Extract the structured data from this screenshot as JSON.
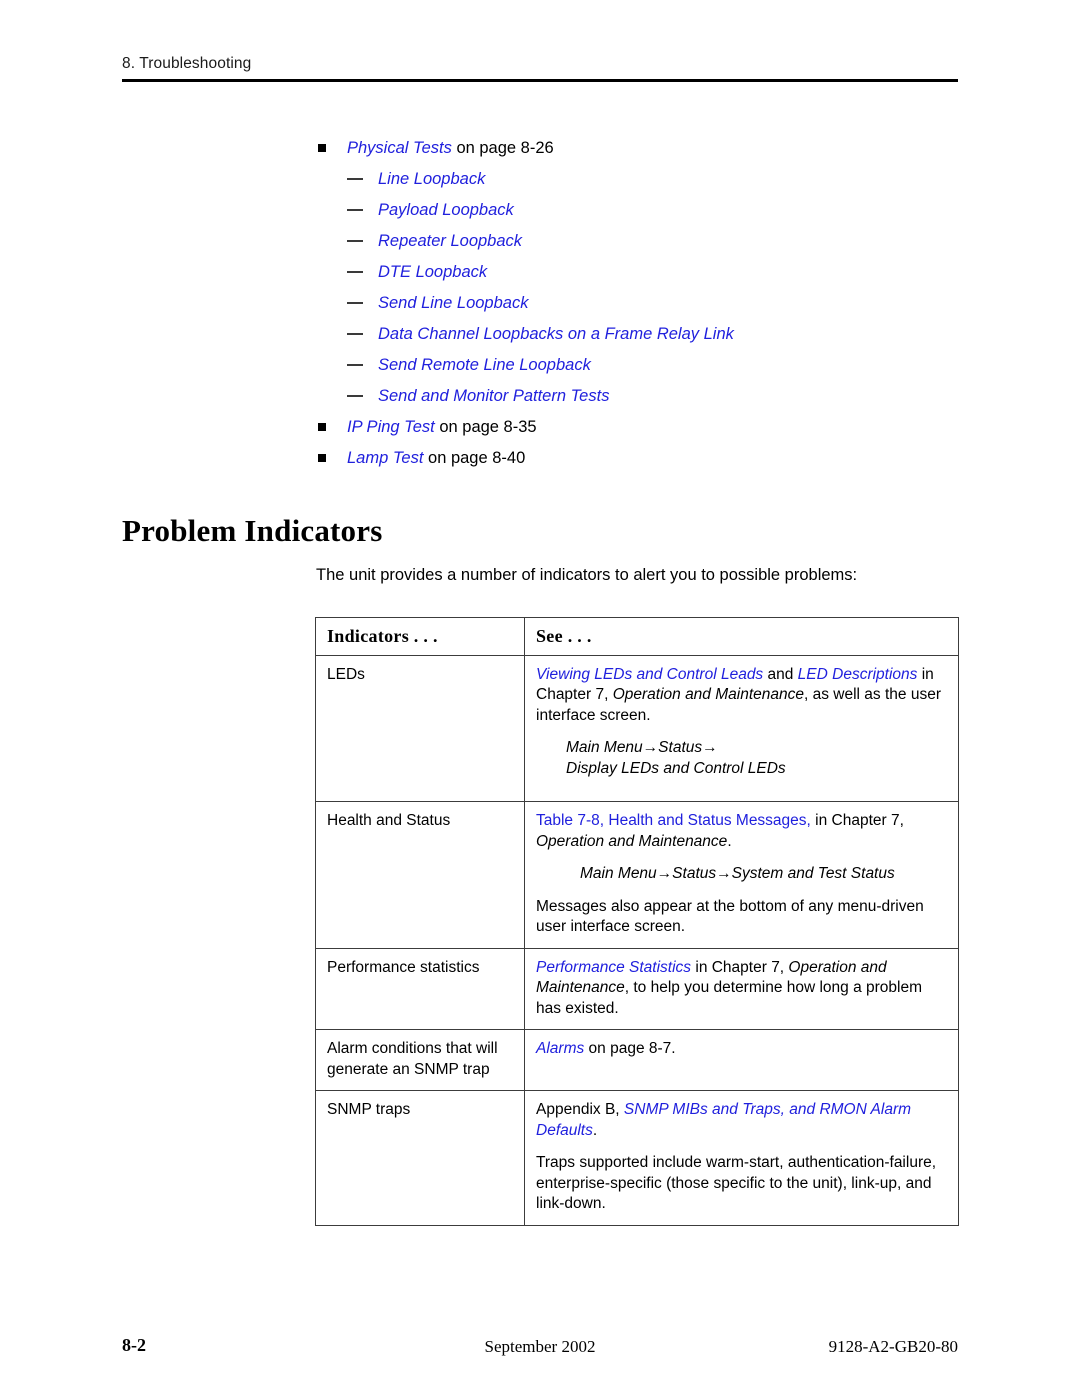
{
  "running_header": {
    "text": "8. Troubleshooting"
  },
  "link_color": "#2020dd",
  "bullets": [
    {
      "level": 1,
      "link": "Physical Tests",
      "trail": " on page 8-26"
    },
    {
      "level": 2,
      "link": "Line Loopback",
      "trail": ""
    },
    {
      "level": 2,
      "link": "Payload Loopback",
      "trail": ""
    },
    {
      "level": 2,
      "link": "Repeater Loopback",
      "trail": ""
    },
    {
      "level": 2,
      "link": "DTE Loopback",
      "trail": ""
    },
    {
      "level": 2,
      "link": "Send Line Loopback",
      "trail": ""
    },
    {
      "level": 2,
      "link": "Data Channel Loopbacks on a Frame Relay Link",
      "trail": ""
    },
    {
      "level": 2,
      "link": "Send Remote Line Loopback",
      "trail": ""
    },
    {
      "level": 2,
      "link": "Send and Monitor Pattern Tests",
      "trail": ""
    },
    {
      "level": 1,
      "link": "IP Ping Test",
      "trail": " on page 8-35"
    },
    {
      "level": 1,
      "link": "Lamp Test",
      "trail": " on page 8-40"
    }
  ],
  "section": {
    "heading": "Problem Indicators",
    "intro": "The unit provides a number of indicators to alert you to possible problems:"
  },
  "table": {
    "headers": {
      "indicators": "Indicators . . .",
      "see": "See . . ."
    },
    "rows": [
      {
        "indicator": "LEDs",
        "see": {
          "p1": {
            "link1": "Viewing LEDs and Control Leads",
            "mid": " and ",
            "link2": "LED Descriptions",
            "tail_a": " in Chapter 7, ",
            "ital1": "Operation and Maintenance",
            "tail_b": ", as well as the user interface screen."
          },
          "menu": "Main Menu→Status→",
          "menu2": "Display LEDs and Control LEDs"
        }
      },
      {
        "indicator": "Health and Status",
        "see": {
          "link_up": "Table 7-8, Health and Status Messages,",
          "tail_a": " in Chapter 7, ",
          "ital1": "Operation and Maintenance",
          "tail_b": ".",
          "menu": "Main Menu→Status→System and Test Status",
          "p2": "Messages also appear at the bottom of any menu-driven user interface screen."
        }
      },
      {
        "indicator": "Performance statistics",
        "see": {
          "link1": "Performance Statistics",
          "tail_a": " in Chapter 7, ",
          "ital1": "Operation and Maintenance",
          "tail_b": ", to help you determine how long a problem has existed."
        }
      },
      {
        "indicator": "Alarm conditions that will generate an SNMP trap",
        "see": {
          "link1": "Alarms",
          "tail_a": " on page 8-7."
        }
      },
      {
        "indicator": "SNMP traps",
        "see": {
          "lead": "Appendix B, ",
          "link1": "SNMP MIBs and Traps, and RMON Alarm Defaults",
          "tail_a": ".",
          "p2": "Traps supported include warm-start, authentication-failure, enterprise-specific (those specific to the unit), link-up, and link-down."
        }
      }
    ]
  },
  "footer": {
    "page_number": "8-2",
    "date": "September 2002",
    "doc_number": "9128-A2-GB20-80"
  }
}
